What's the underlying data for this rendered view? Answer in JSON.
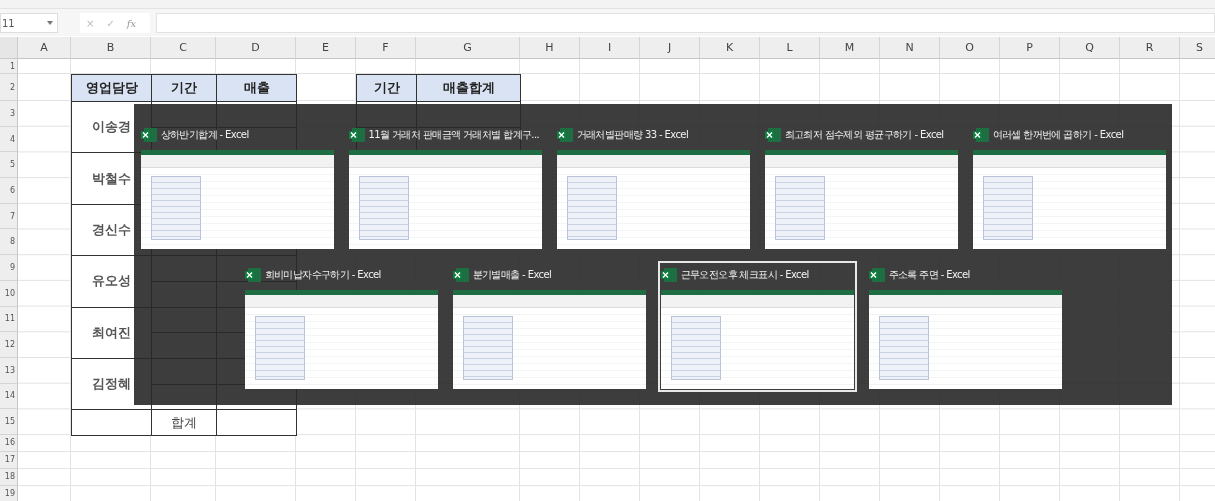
{
  "formula_bar": {
    "name_box": "11",
    "buttons": [
      "×",
      "✓",
      "fx"
    ]
  },
  "columns": [
    "A",
    "B",
    "C",
    "D",
    "E",
    "F",
    "G",
    "H",
    "I",
    "J",
    "K",
    "L",
    "M",
    "N",
    "O",
    "P",
    "Q",
    "R",
    "S"
  ],
  "rows": [
    "1",
    "2",
    "3",
    "4",
    "5",
    "6",
    "7",
    "8",
    "9",
    "10",
    "11",
    "12",
    "13",
    "14",
    "15",
    "16",
    "17",
    "18",
    "19"
  ],
  "sales_table": {
    "headers": [
      "영업담당",
      "기간",
      "매출"
    ],
    "groups": [
      {
        "name": "이송경"
      },
      {
        "name": "박철수"
      },
      {
        "name": "경신수"
      },
      {
        "name": "유오성"
      },
      {
        "name": "최여진"
      },
      {
        "name": "김정혜"
      }
    ],
    "total_label": "합계"
  },
  "summary_table": {
    "headers": [
      "기간",
      "매출합계"
    ]
  },
  "window_switcher": {
    "rows": [
      [
        {
          "title": "상하반기합계 - Excel",
          "selected": false
        },
        {
          "title": "11월 거래처 판매금액 거래처별 합계구...",
          "selected": false
        },
        {
          "title": "거래처별판매량 33 - Excel",
          "selected": false
        },
        {
          "title": "최고최저 점수제외 평균구하기 - Excel",
          "selected": false
        },
        {
          "title": "여러셀 한꺼번에 곱하기 - Excel",
          "selected": false
        }
      ],
      [
        {
          "title": "회비미납자수구하기 - Excel",
          "selected": false
        },
        {
          "title": "분기별매출 - Excel",
          "selected": false
        },
        {
          "title": "근무오전오후 체크표시 - Excel",
          "selected": true
        },
        {
          "title": "주소록 주면 - Excel",
          "selected": false
        }
      ]
    ]
  }
}
